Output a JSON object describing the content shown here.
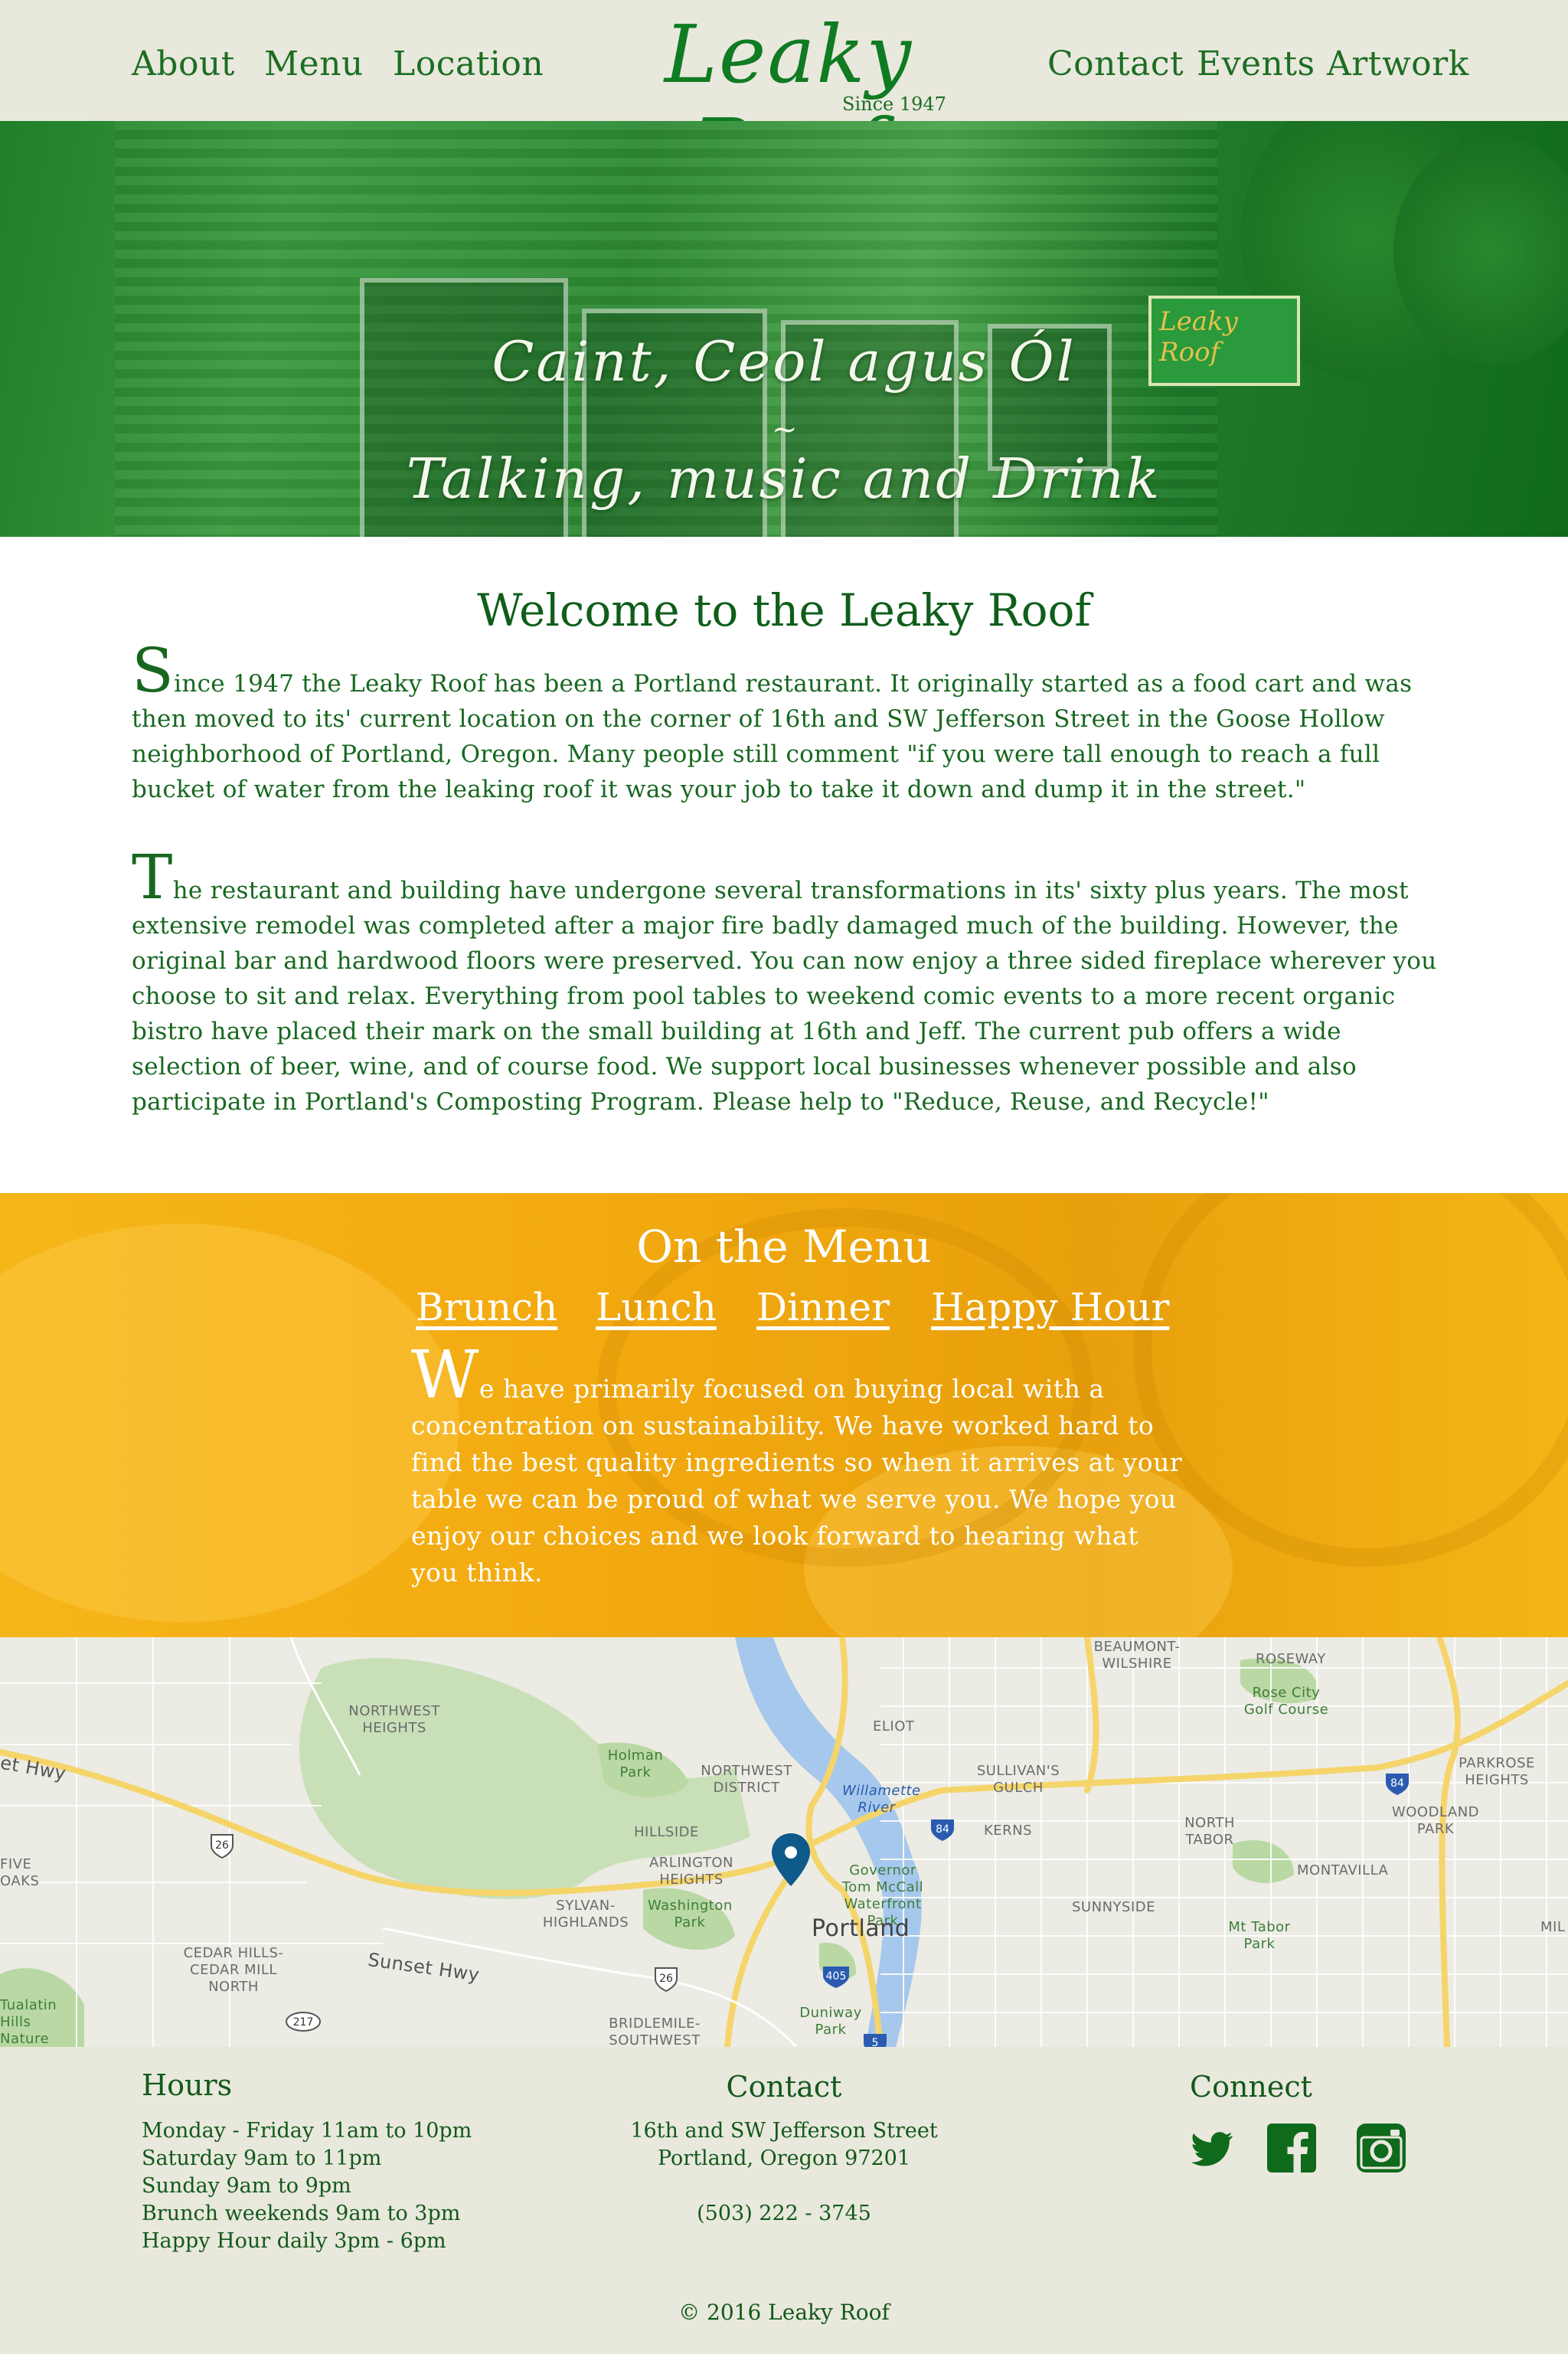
{
  "nav": {
    "items_left": [
      "About",
      "Menu",
      "Location"
    ],
    "items_right": [
      "Contact",
      "Events",
      "Artwork"
    ],
    "logo_name": "Leaky Roof",
    "logo_since": "Since 1947"
  },
  "hero": {
    "line1": "Caint, Ceol agus Ól",
    "separator": "~",
    "line2": "Talking, music and Drink",
    "sign_text": "Leaky Roof"
  },
  "welcome": {
    "title": "Welcome to the Leaky Roof",
    "p1_first": "S",
    "p1_rest": "ince 1947 the Leaky Roof has been a Portland restaurant. It originally started as a food cart and was then moved to its' current location on the corner of 16th and SW Jefferson Street in the Goose Hollow neighborhood of Portland, Oregon. Many people still comment \"if you were tall enough to reach a full bucket of water from the leaking roof it was your job to take it down and dump it in the street.\"",
    "p2_first": "T",
    "p2_rest": "he restaurant and building have undergone several transformations in its' sixty plus years. The most extensive remodel was completed after a major fire badly damaged much of the building. However, the original bar and hardwood floors were preserved. You can now enjoy a three sided fireplace wherever you choose to sit and relax. Everything from pool tables to weekend comic events to a more recent organic bistro have placed their mark on the small building at 16th and Jeff. The current pub offers a wide selection of beer, wine, and of course food. We support local businesses whenever possible and also participate in Portland's Composting Program. Please help to \"Reduce, Reuse, and Recycle!\""
  },
  "menu": {
    "title": "On the Menu",
    "links": [
      "Brunch",
      "Lunch",
      "Dinner",
      "Happy Hour"
    ],
    "text_first": "W",
    "text_rest": "e have primarily focused on buying local with a concentration on sustainability. We have worked hard to find the best quality ingredients so when it arrives at your table we can be proud of what we serve you. We hope you enjoy our choices and we look forward to hearing what you think."
  },
  "map": {
    "labels": {
      "beaumont": "BEAUMONT-WILSHIRE",
      "roseway": "ROSEWAY",
      "rosecity": "Rose City Golf Course",
      "northwest": "NORTHWEST HEIGHTS",
      "holman": "Holman Park",
      "nwdistrict": "NORTHWEST DISTRICT",
      "eliot": "ELIOT",
      "sullivans": "SULLIVAN'S GULCH",
      "parkrose": "PARKROSE HEIGHTS",
      "willamette": "Willamette River",
      "woodland": "WOODLAND PARK",
      "hillside": "HILLSIDE",
      "kerns": "KERNS",
      "northtabor": "NORTH TABOR",
      "five": "FIVE OAKS",
      "arlington": "ARLINGTON HEIGHTS",
      "mccall": "Governor Tom McCall Waterfront Park",
      "montavilla": "MONTAVILLA",
      "washington": "Washington Park",
      "sylvan": "SYLVAN-HIGHLANDS",
      "sunnyside": "SUNNYSIDE",
      "portland": "Portland",
      "mttabor": "Mt Tabor Park",
      "cedar": "CEDAR HILLS-CEDAR MILL NORTH",
      "sunsethwy": "Sunset Hwy",
      "sethwy": "et Hwy",
      "duniway": "Duniway Park",
      "tualatin": "Tualatin Hills Nature Park",
      "bridlemile": "BRIDLEMILE-SOUTHWEST",
      "mil": "MIL"
    },
    "shields": [
      "26",
      "84",
      "84",
      "405",
      "26",
      "217",
      "5"
    ],
    "pin_color": "#0e5a8a"
  },
  "footer": {
    "hours_title": "Hours",
    "hours": [
      "Monday - Friday 11am to 10pm",
      "Saturday 9am to 11pm",
      "Sunday 9am to 9pm",
      "Brunch weekends 9am to 3pm",
      "Happy Hour daily 3pm - 6pm"
    ],
    "contact_title": "Contact",
    "address1": "16th and SW Jefferson Street",
    "address2": "Portland, Oregon 97201",
    "phone": "(503) 222 - 3745",
    "connect_title": "Connect",
    "social": [
      "twitter-icon",
      "facebook-icon",
      "instagram-icon"
    ],
    "copyright": "© 2016 Leaky Roof"
  },
  "colors": {
    "brand_green": "#0f7b22",
    "menu_gold": "#f2a90f",
    "nav_bg": "#e9e8dd"
  }
}
